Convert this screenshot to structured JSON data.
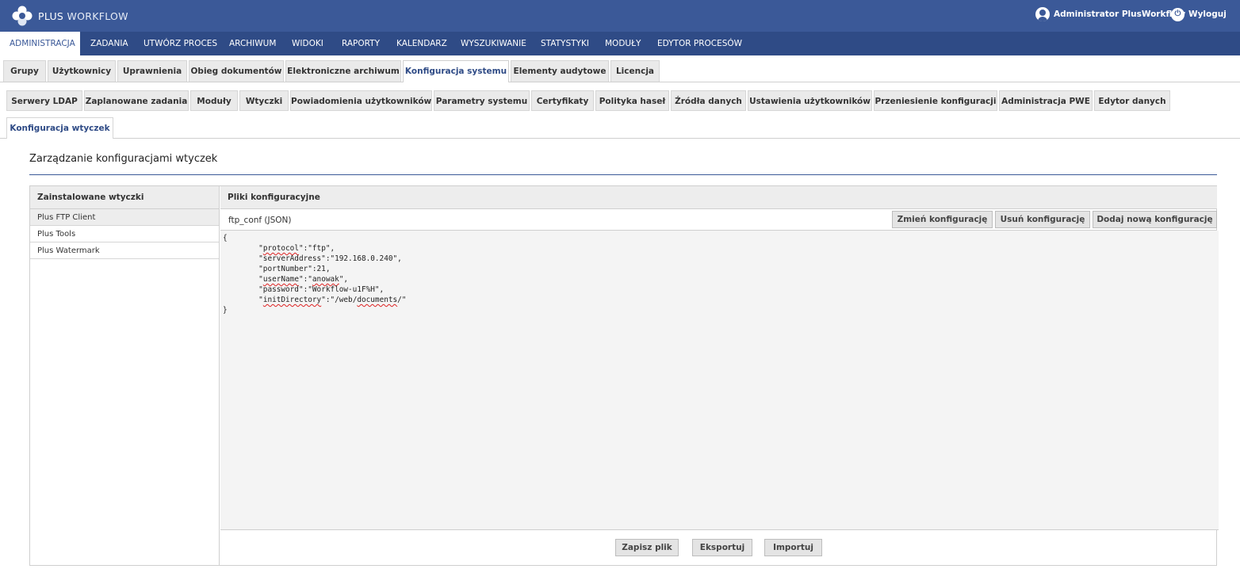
{
  "app": {
    "logo_word1": "PLUS",
    "logo_word2": "WORKFLOW"
  },
  "header": {
    "user_name": "Administrator PlusWorkflow",
    "logout_label": "Wyloguj",
    "user_icon": "user-icon",
    "logout_icon": "power-icon"
  },
  "main_nav": [
    "ADMINISTRACJA",
    "ZADANIA",
    "UTWÓRZ PROCES",
    "ARCHIWUM",
    "WIDOKI",
    "RAPORTY",
    "KALENDARZ",
    "WYSZUKIWANIE",
    "STATYSTYKI",
    "MODUŁY",
    "EDYTOR PROCESÓW"
  ],
  "main_nav_active": "ADMINISTRACJA",
  "tabs": [
    "Grupy",
    "Użytkownicy",
    "Uprawnienia",
    "Obieg dokumentów",
    "Elektroniczne archiwum",
    "Konfiguracja systemu",
    "Elementy audytowe",
    "Licencja"
  ],
  "tabs_active": "Konfiguracja systemu",
  "subtabs": [
    "Serwery LDAP",
    "Zaplanowane zadania",
    "Moduły",
    "Wtyczki",
    "Powiadomienia użytkowników",
    "Parametry systemu",
    "Certyfikaty",
    "Polityka haseł",
    "Źródła danych",
    "Ustawienia użytkowników",
    "Przeniesienie konfiguracji",
    "Administracja PWE",
    "Edytor danych",
    "Konfiguracja wtyczek"
  ],
  "subtabs_active": "Konfiguracja wtyczek",
  "page_title": "Zarządzanie konfiguracjami wtyczek",
  "plugins": {
    "header": "Zainstalowane wtyczki",
    "items": [
      "Plus FTP Client",
      "Plus Tools",
      "Plus Watermark"
    ],
    "selected": "Plus FTP Client"
  },
  "config": {
    "header": "Pliki konfiguracyjne",
    "file_name": "ftp_conf (JSON)",
    "buttons": {
      "change": "Zmień konfigurację",
      "delete": "Usuń konfigurację",
      "add": "Dodaj nową konfigurację"
    },
    "editor_lines": [
      "{",
      "        \"protocol\":\"ftp\",",
      "        \"serverAddress\":\"192.168.0.240\",",
      "        \"portNumber\":21,",
      "        \"userName\":\"anowak\",",
      "        \"password\":\"Workflow-u1F%H\",",
      "        \"initDirectory\":\"/web/documents/\"",
      "}"
    ],
    "footer_buttons": {
      "save": "Zapisz plik",
      "export": "Eksportuj",
      "import": "Importuj"
    }
  },
  "colors": {
    "brand": "#3b5998",
    "nav": "#2f4b86"
  }
}
